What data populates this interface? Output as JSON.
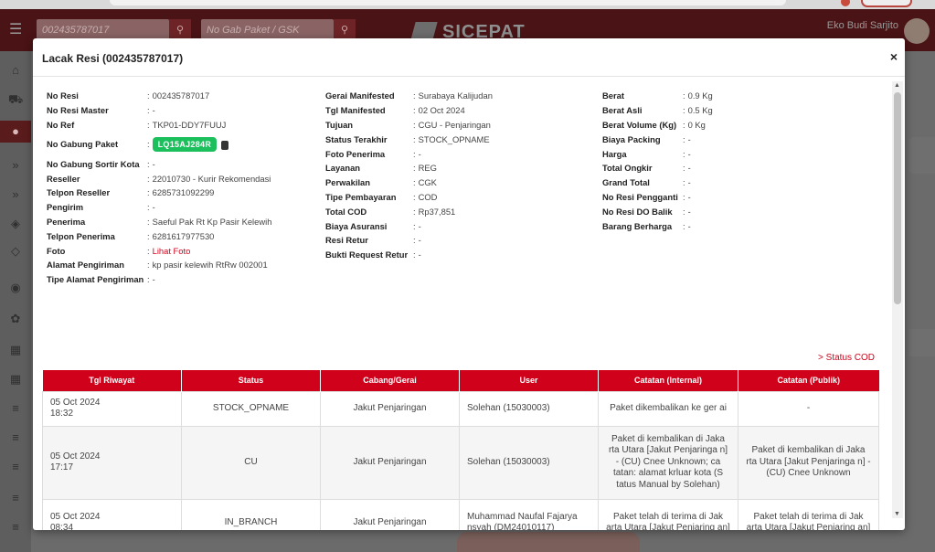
{
  "background": {
    "search_value": "002435787017",
    "gabung_placeholder": "No Gab Paket / GSK",
    "logo_text": "SICEPAT",
    "user_name": "Eko Budi Sarjito"
  },
  "modal": {
    "title": "Lacak Resi (002435787017)",
    "close_label": "×",
    "status_cod_link": "> Status COD"
  },
  "details": {
    "col1": [
      {
        "label": "No Resi",
        "value": "002435787017"
      },
      {
        "label": "No Resi Master",
        "value": "-"
      },
      {
        "label": "No Ref",
        "value": "TKP01-DDY7FUUJ"
      },
      {
        "label": "No Gabung Paket",
        "value": "LQ15AJ284R",
        "badge": true
      },
      {
        "label": "No Gabung Sortir Kota",
        "value": "-"
      },
      {
        "label": "Reseller",
        "value": "22010730 - Kurir Rekomendasi"
      },
      {
        "label": "Telpon Reseller",
        "value": "6285731092299"
      },
      {
        "label": "Pengirim",
        "value": "-"
      },
      {
        "label": "Penerima",
        "value": "Saeful Pak Rt Kp Pasir Kelewih"
      },
      {
        "label": "Telpon Penerima",
        "value": "6281617977530"
      },
      {
        "label": "Foto",
        "value": "Lihat Foto",
        "link": true
      },
      {
        "label": "Alamat Pengiriman",
        "value": "kp pasir kelewih RtRw 002001"
      },
      {
        "label": "Tipe Alamat Pengiriman",
        "value": "-"
      }
    ],
    "col2": [
      {
        "label": "Gerai Manifested",
        "value": "Surabaya Kalijudan"
      },
      {
        "label": "Tgl Manifested",
        "value": "02 Oct 2024"
      },
      {
        "label": "Tujuan",
        "value": "CGU - Penjaringan"
      },
      {
        "label": "Status Terakhir",
        "value": "STOCK_OPNAME"
      },
      {
        "label": "Foto Penerima",
        "value": "-"
      },
      {
        "label": "Layanan",
        "value": "REG"
      },
      {
        "label": "Perwakilan",
        "value": "CGK"
      },
      {
        "label": "Tipe Pembayaran",
        "value": "COD"
      },
      {
        "label": "Total COD",
        "value": "Rp37,851"
      },
      {
        "label": "Biaya Asuransi",
        "value": "-"
      },
      {
        "label": "Resi Retur",
        "value": "-"
      },
      {
        "label": "Bukti Request Retur",
        "value": "-"
      }
    ],
    "col3": [
      {
        "label": "Berat",
        "value": "0.9 Kg"
      },
      {
        "label": "Berat Asli",
        "value": "0.5 Kg"
      },
      {
        "label": "Berat Volume (Kg)",
        "value": "0 Kg"
      },
      {
        "label": "Biaya Packing",
        "value": "-"
      },
      {
        "label": "Harga",
        "value": "-"
      },
      {
        "label": "Total Ongkir",
        "value": "-"
      },
      {
        "label": "Grand Total",
        "value": "-"
      },
      {
        "label": "No Resi Pengganti",
        "value": "-"
      },
      {
        "label": "No Resi DO Balik",
        "value": "-"
      },
      {
        "label": "Barang Berharga",
        "value": "-"
      }
    ]
  },
  "history": {
    "headers": [
      "Tgl Riwayat",
      "Status",
      "Cabang/Gerai",
      "User",
      "Catatan (Internal)",
      "Catatan (Publik)"
    ],
    "rows": [
      {
        "date": "05 Oct 2024",
        "time": "18:32",
        "status": "STOCK_OPNAME",
        "cabang": "Jakut Penjaringan",
        "user": "Solehan (15030003)",
        "internal": "Paket dikembalikan ke ger ai",
        "publik": "-"
      },
      {
        "date": "05 Oct 2024",
        "time": "17:17",
        "status": "CU",
        "cabang": "Jakut Penjaringan",
        "user": "Solehan (15030003)",
        "internal": "Paket di kembalikan di Jaka rta Utara [Jakut Penjaringa n] - (CU) Cnee Unknown; ca tatan: alamat krluar kota (S tatus Manual by Solehan)",
        "publik": "Paket di kembalikan di Jaka rta Utara [Jakut Penjaringa n] - (CU) Cnee Unknown"
      },
      {
        "date": "05 Oct 2024",
        "time": "08:34",
        "status": "IN_BRANCH",
        "cabang": "Jakut Penjaringan",
        "user": "Muhammad Naufal Fajarya nsyah (DM24010117)",
        "internal": "Paket telah di terima di Jak arta Utara [Jakut Penjaring an]",
        "publik": "Paket telah di terima di Jak arta Utara [Jakut Penjaring an]"
      }
    ]
  }
}
